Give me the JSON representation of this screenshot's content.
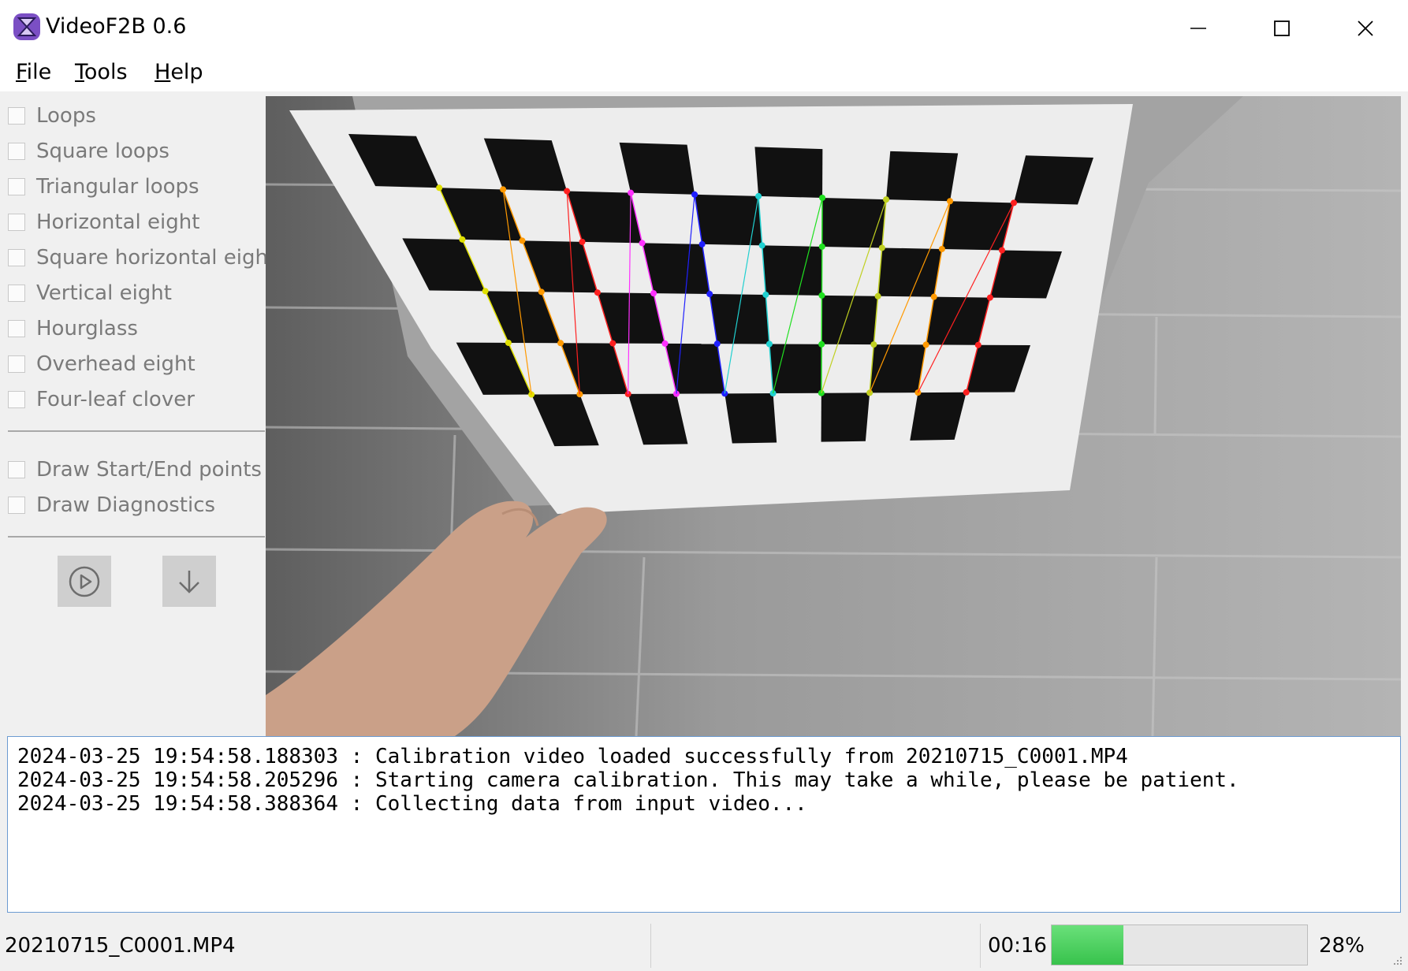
{
  "window": {
    "title": "VideoF2B 0.6",
    "icon": "app-hourglass-icon",
    "controls": [
      "minimize-icon",
      "maximize-icon",
      "close-icon"
    ]
  },
  "menu": [
    {
      "label": "File",
      "mnemonic": "F",
      "rest": "ile"
    },
    {
      "label": "Tools",
      "mnemonic": "T",
      "rest": "ools"
    },
    {
      "label": "Help",
      "mnemonic": "H",
      "rest": "elp"
    }
  ],
  "figures": [
    {
      "label": "Loops",
      "checked": false
    },
    {
      "label": "Square loops",
      "checked": false
    },
    {
      "label": "Triangular loops",
      "checked": false
    },
    {
      "label": "Horizontal eight",
      "checked": false
    },
    {
      "label": "Square horizontal eight",
      "checked": false
    },
    {
      "label": "Vertical eight",
      "checked": false
    },
    {
      "label": "Hourglass",
      "checked": false
    },
    {
      "label": "Overhead eight",
      "checked": false
    },
    {
      "label": "Four-leaf clover",
      "checked": false
    }
  ],
  "options": [
    {
      "label": "Draw Start/End points",
      "checked": false
    },
    {
      "label": "Draw Diagnostics",
      "checked": false
    }
  ],
  "buttons": {
    "play_icon": "play-circle-icon",
    "down_icon": "arrow-down-icon"
  },
  "log": [
    "2024-03-25 19:54:58.188303 : Calibration video loaded successfully from 20210715_C0001.MP4",
    "2024-03-25 19:54:58.205296 : Starting camera calibration. This may take a while, please be patient.",
    "2024-03-25 19:54:58.388364 : Collecting data from input video..."
  ],
  "status": {
    "filename": "20210715_C0001.MP4",
    "elapsed": "00:16",
    "progress_fraction": 0.28,
    "progress_text": "28%"
  },
  "colors": {
    "accent": "#6c9bd1",
    "progress": "#4cd160",
    "app_icon": "#7b4fc4"
  }
}
